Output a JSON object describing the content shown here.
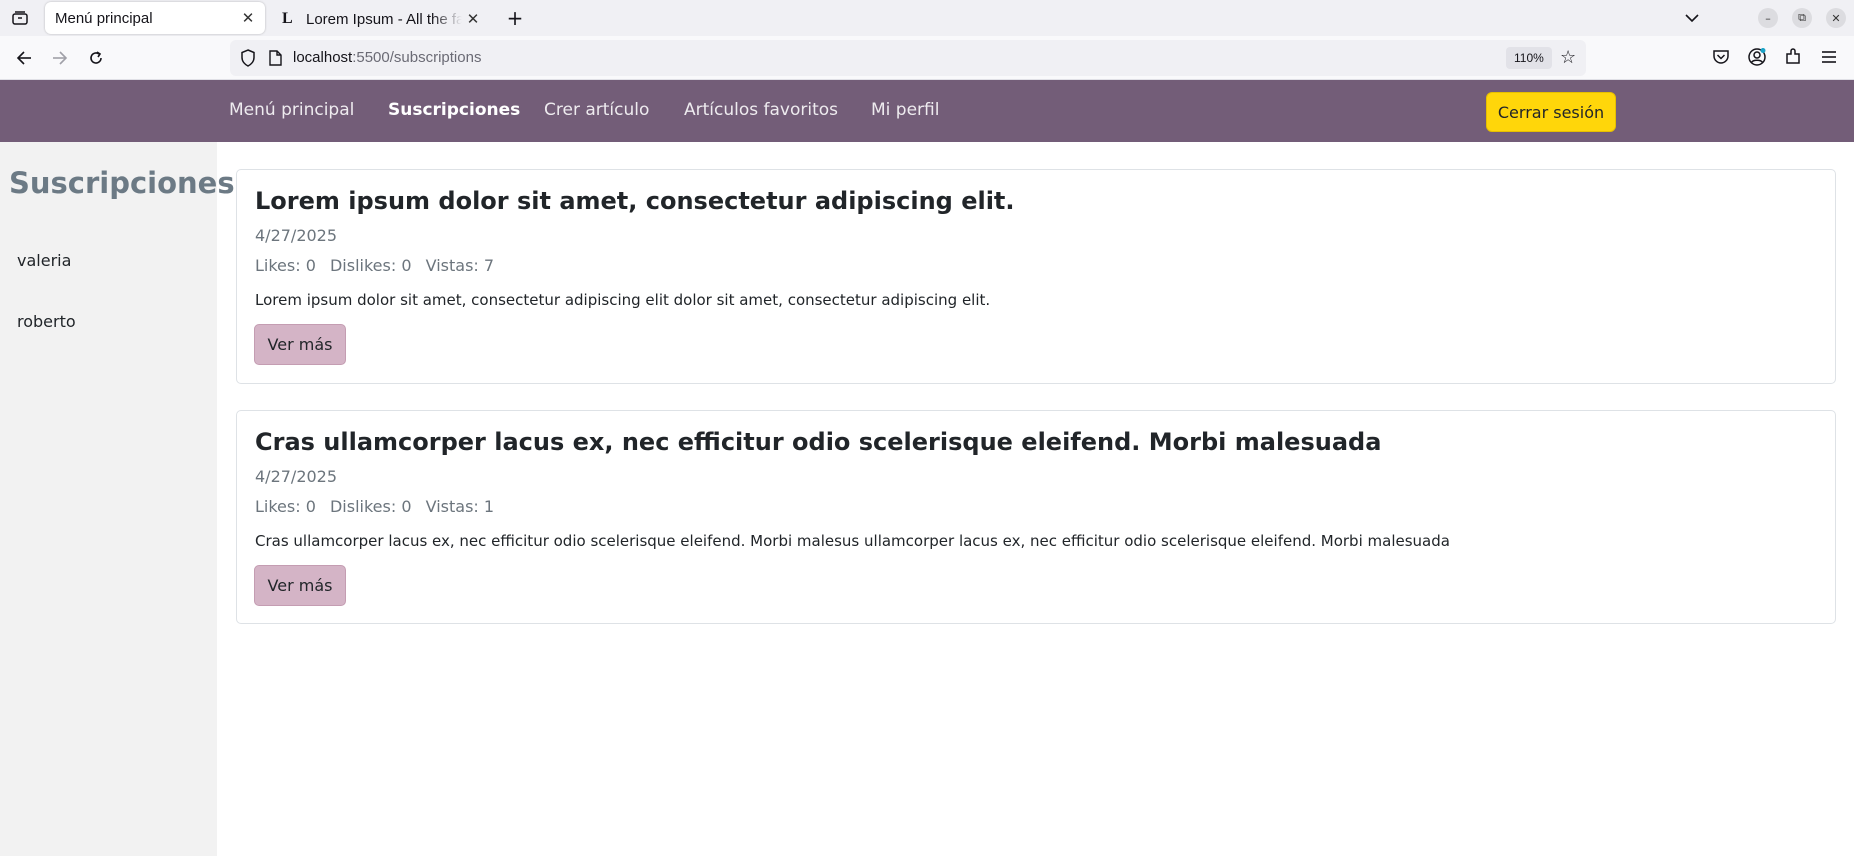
{
  "browser": {
    "tabs": [
      {
        "title": "Menú principal",
        "active": true
      },
      {
        "title": "Lorem Ipsum - All the facts - Lipsum generator",
        "active": false,
        "favicon": "L"
      }
    ],
    "url_host": "localhost",
    "url_path": ":5500/subscriptions",
    "zoom": "110%",
    "icons": [
      "tab-list-icon",
      "close-icon",
      "new-tab-icon",
      "chevron-down-icon",
      "minimize-icon",
      "restore-icon",
      "close-window-icon",
      "back-icon",
      "forward-icon",
      "reload-icon",
      "shield-icon",
      "page-icon",
      "star-icon",
      "pocket-icon",
      "account-icon",
      "extensions-icon",
      "menu-icon"
    ]
  },
  "site_nav": {
    "links": [
      {
        "label": "Menú principal",
        "active": false
      },
      {
        "label": "Suscripciones",
        "active": true
      },
      {
        "label": "Crer artículo",
        "active": false
      },
      {
        "label": "Artículos favoritos",
        "active": false
      },
      {
        "label": "Mi perfil",
        "active": false
      }
    ],
    "logout_label": "Cerrar sesión",
    "colors": {
      "navbar": "#735d78",
      "logout": "#ffd60a"
    }
  },
  "sidebar": {
    "title": "Suscripciones",
    "items": [
      "valeria",
      "roberto"
    ]
  },
  "articles": [
    {
      "title": "Lorem ipsum dolor sit amet, consectetur adipiscing elit.",
      "date": "4/27/2025",
      "likes": "Likes: 0",
      "dislikes": "Dislikes: 0",
      "views": "Vistas: 7",
      "excerpt": "Lorem ipsum dolor sit amet, consectetur adipiscing elit dolor sit amet, consectetur adipiscing elit.",
      "button_label": "Ver más"
    },
    {
      "title": "Cras ullamcorper lacus ex, nec efficitur odio scelerisque eleifend. Morbi malesuada",
      "date": "4/27/2025",
      "likes": "Likes: 0",
      "dislikes": "Dislikes: 0",
      "views": "Vistas: 1",
      "excerpt": "Cras ullamcorper lacus ex, nec efficitur odio scelerisque eleifend. Morbi malesus ullamcorper lacus ex, nec efficitur odio scelerisque eleifend. Morbi malesuada",
      "button_label": "Ver más"
    }
  ]
}
